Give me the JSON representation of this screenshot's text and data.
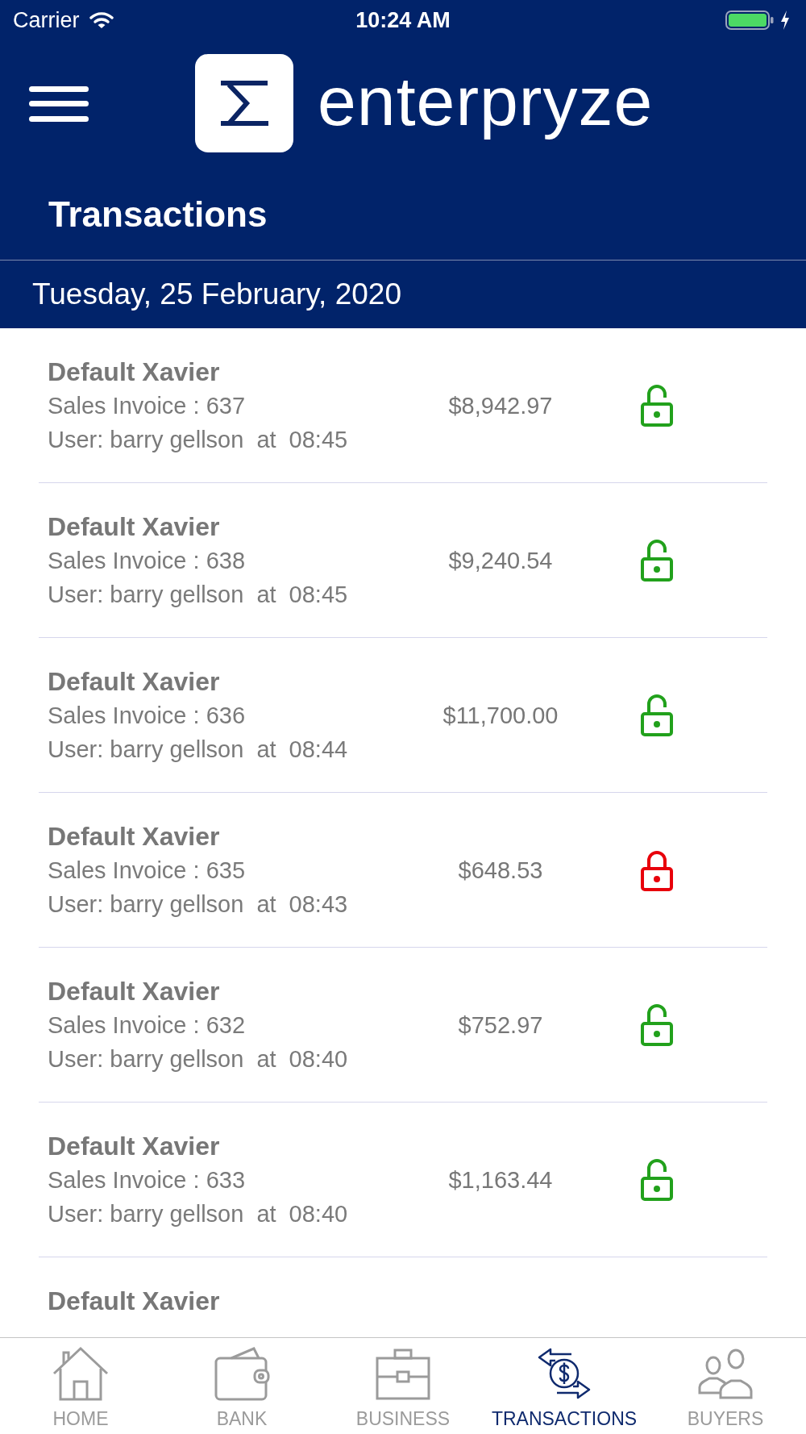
{
  "status_bar": {
    "carrier": "Carrier",
    "time": "10:24 AM"
  },
  "header": {
    "brand": "enterpryze",
    "title": "Transactions"
  },
  "date_bar": {
    "date": "Tuesday, 25 February, 2020"
  },
  "transactions": [
    {
      "customer": "Default Xavier",
      "invoice": "Sales Invoice : 637",
      "user": "User: barry gellson",
      "at": "at",
      "time": "08:45",
      "amount": "$8,942.97",
      "locked": false
    },
    {
      "customer": "Default Xavier",
      "invoice": "Sales Invoice : 638",
      "user": "User: barry gellson",
      "at": "at",
      "time": "08:45",
      "amount": "$9,240.54",
      "locked": false
    },
    {
      "customer": "Default Xavier",
      "invoice": "Sales Invoice : 636",
      "user": "User: barry gellson",
      "at": "at",
      "time": "08:44",
      "amount": "$11,700.00",
      "locked": false
    },
    {
      "customer": "Default Xavier",
      "invoice": "Sales Invoice : 635",
      "user": "User: barry gellson",
      "at": "at",
      "time": "08:43",
      "amount": "$648.53",
      "locked": true
    },
    {
      "customer": "Default Xavier",
      "invoice": "Sales Invoice : 632",
      "user": "User: barry gellson",
      "at": "at",
      "time": "08:40",
      "amount": "$752.97",
      "locked": false
    },
    {
      "customer": "Default Xavier",
      "invoice": "Sales Invoice : 633",
      "user": "User: barry gellson",
      "at": "at",
      "time": "08:40",
      "amount": "$1,163.44",
      "locked": false
    },
    {
      "customer": "Default Xavier"
    }
  ],
  "tab_bar": [
    {
      "kind": "home",
      "label": "HOME",
      "selected": false
    },
    {
      "kind": "bank",
      "label": "BANK",
      "selected": false
    },
    {
      "kind": "business",
      "label": "BUSINESS",
      "selected": false
    },
    {
      "kind": "transactions",
      "label": "TRANSACTIONS",
      "selected": true
    },
    {
      "kind": "buyers",
      "label": "BUYERS",
      "selected": false
    }
  ]
}
